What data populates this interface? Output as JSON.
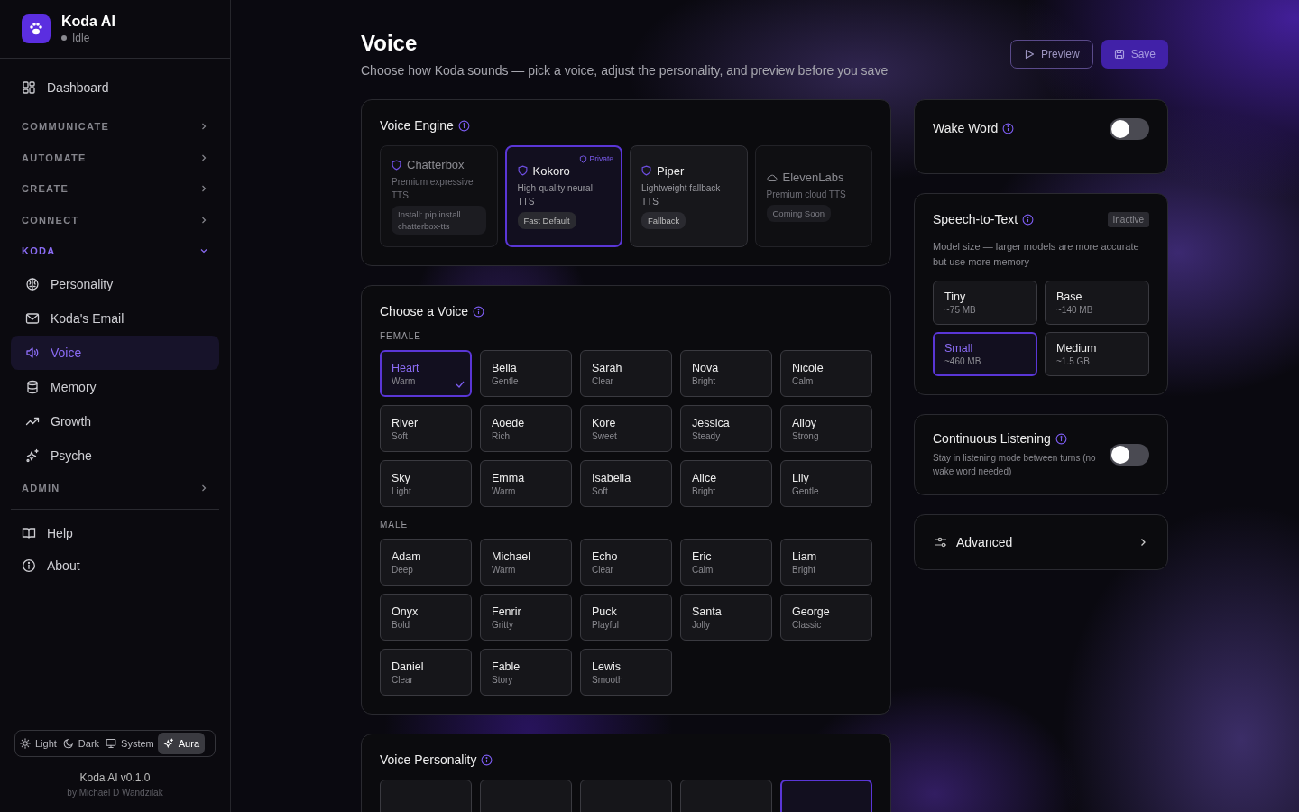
{
  "sidebar": {
    "app_name": "Koda AI",
    "status": "Idle",
    "nav": [
      {
        "kind": "link",
        "label": "Dashboard",
        "selected": false
      },
      {
        "kind": "section",
        "label": "COMMUNICATE",
        "expanded": false
      },
      {
        "kind": "section",
        "label": "AUTOMATE",
        "expanded": false
      },
      {
        "kind": "section",
        "label": "CREATE",
        "expanded": false
      },
      {
        "kind": "section",
        "label": "CONNECT",
        "expanded": false
      },
      {
        "kind": "section",
        "label": "KODA",
        "expanded": true,
        "children": [
          {
            "label": "Personality",
            "selected": false
          },
          {
            "label": "Koda's Email",
            "selected": false
          },
          {
            "label": "Voice",
            "selected": true
          },
          {
            "label": "Memory",
            "selected": false
          },
          {
            "label": "Growth",
            "selected": false
          },
          {
            "label": "Psyche",
            "selected": false
          }
        ]
      },
      {
        "kind": "section",
        "label": "ADMIN",
        "expanded": false
      }
    ],
    "footer_links": [
      "Help",
      "About"
    ],
    "themes": [
      {
        "label": "Light",
        "selected": false
      },
      {
        "label": "Dark",
        "selected": false
      },
      {
        "label": "System",
        "selected": false
      },
      {
        "label": "Aura",
        "selected": true
      }
    ],
    "version": "Koda AI v0.1.0",
    "author": "by Michael D Wandzilak"
  },
  "page": {
    "title": "Voice",
    "subtitle": "Choose how Koda sounds — pick a voice, adjust the personality, and preview before you save",
    "buttons": [
      "Preview",
      "Save"
    ]
  },
  "voice_engine": {
    "title": "Voice Engine",
    "engines": [
      {
        "name": "Chatterbox",
        "kind": "local",
        "description": "Premium expressive TTS",
        "tag": "Install: pip install chatterbox-tts",
        "selected": false,
        "disabled": true
      },
      {
        "name": "Kokoro",
        "kind": "local",
        "description": "High-quality neural TTS",
        "tag": "Fast Default",
        "badge": "Private",
        "selected": true,
        "disabled": false
      },
      {
        "name": "Piper",
        "kind": "local",
        "description": "Lightweight fallback TTS",
        "tag": "Fallback",
        "selected": false,
        "disabled": false
      },
      {
        "name": "ElevenLabs",
        "kind": "cloud",
        "description": "Premium cloud TTS",
        "tag": "Coming Soon",
        "selected": false,
        "disabled": true
      }
    ]
  },
  "choose_voice": {
    "title": "Choose a Voice",
    "groups": [
      {
        "label": "FEMALE",
        "voices": [
          {
            "name": "Heart",
            "trait": "Warm",
            "selected": true
          },
          {
            "name": "Bella",
            "trait": "Gentle",
            "selected": false
          },
          {
            "name": "Sarah",
            "trait": "Clear",
            "selected": false
          },
          {
            "name": "Nova",
            "trait": "Bright",
            "selected": false
          },
          {
            "name": "Nicole",
            "trait": "Calm",
            "selected": false
          },
          {
            "name": "River",
            "trait": "Soft",
            "selected": false
          },
          {
            "name": "Aoede",
            "trait": "Rich",
            "selected": false
          },
          {
            "name": "Kore",
            "trait": "Sweet",
            "selected": false
          },
          {
            "name": "Jessica",
            "trait": "Steady",
            "selected": false
          },
          {
            "name": "Alloy",
            "trait": "Strong",
            "selected": false
          },
          {
            "name": "Sky",
            "trait": "Light",
            "selected": false
          },
          {
            "name": "Emma",
            "trait": "Warm",
            "selected": false
          },
          {
            "name": "Isabella",
            "trait": "Soft",
            "selected": false
          },
          {
            "name": "Alice",
            "trait": "Bright",
            "selected": false
          },
          {
            "name": "Lily",
            "trait": "Gentle",
            "selected": false
          }
        ]
      },
      {
        "label": "MALE",
        "voices": [
          {
            "name": "Adam",
            "trait": "Deep",
            "selected": false
          },
          {
            "name": "Michael",
            "trait": "Warm",
            "selected": false
          },
          {
            "name": "Echo",
            "trait": "Clear",
            "selected": false
          },
          {
            "name": "Eric",
            "trait": "Calm",
            "selected": false
          },
          {
            "name": "Liam",
            "trait": "Bright",
            "selected": false
          },
          {
            "name": "Onyx",
            "trait": "Bold",
            "selected": false
          },
          {
            "name": "Fenrir",
            "trait": "Gritty",
            "selected": false
          },
          {
            "name": "Puck",
            "trait": "Playful",
            "selected": false
          },
          {
            "name": "Santa",
            "trait": "Jolly",
            "selected": false
          },
          {
            "name": "George",
            "trait": "Classic",
            "selected": false
          },
          {
            "name": "Daniel",
            "trait": "Clear",
            "selected": false
          },
          {
            "name": "Fable",
            "trait": "Story",
            "selected": false
          },
          {
            "name": "Lewis",
            "trait": "Smooth",
            "selected": false
          }
        ]
      }
    ]
  },
  "voice_personality": {
    "title": "Voice Personality",
    "presets": [
      {
        "selected": false
      },
      {
        "selected": false
      },
      {
        "selected": false
      },
      {
        "selected": false
      },
      {
        "selected": true
      }
    ]
  },
  "wake_word": {
    "title": "Wake Word",
    "on": false
  },
  "speech_to_text": {
    "title": "Speech-to-Text",
    "status": "Inactive",
    "description": "Model size — larger models are more accurate but use more memory",
    "models": [
      {
        "name": "Tiny",
        "size": "~75 MB",
        "selected": false
      },
      {
        "name": "Base",
        "size": "~140 MB",
        "selected": false
      },
      {
        "name": "Small",
        "size": "~460 MB",
        "selected": true
      },
      {
        "name": "Medium",
        "size": "~1.5 GB",
        "selected": false
      }
    ]
  },
  "continuous_listening": {
    "title": "Continuous Listening",
    "description": "Stay in listening mode between turns (no wake word needed)",
    "on": false
  },
  "advanced": {
    "title": "Advanced"
  }
}
